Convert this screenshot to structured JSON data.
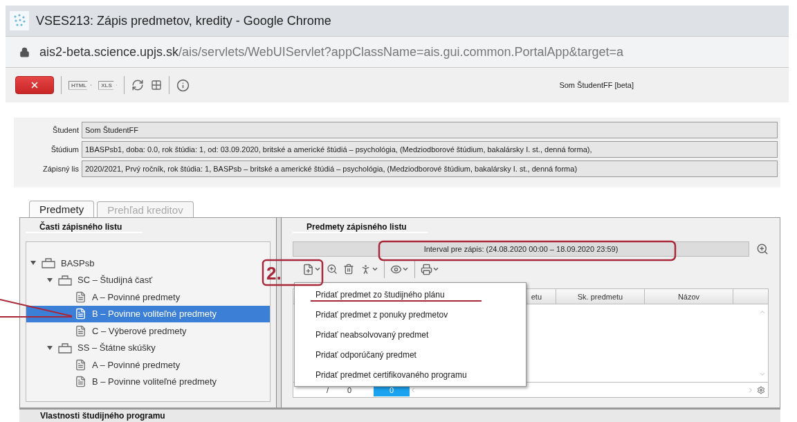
{
  "browser": {
    "title": "VSES213: Zápis predmetov, kredity - Google Chrome",
    "url_host": "ais2-beta.science.upjs.sk",
    "url_path": "/ais/servlets/WebUIServlet?appClassName=ais.gui.common.PortalApp&target=a"
  },
  "toolbar": {
    "export_buttons": [
      "HTML",
      "XLS"
    ],
    "user": "Som ŠtudentFF [beta]"
  },
  "fields": [
    {
      "label": "Študent",
      "value": "Som ŠtudentFF"
    },
    {
      "label": "Štúdium",
      "value": "1BASPsb1, doba: 0.0, rok štúdia: 1, od: 03.09.2020, britské a americké štúdiá – psychológia, (Medziodborové štúdium, bakalársky I. st., denná forma),"
    },
    {
      "label": "Zápisný lis",
      "value": "2020/2021, Prvý ročník, rok štúdia: 1, BASPsb – britské a americké štúdiá – psychológia, (Medziodborové štúdium, bakalársky I. st., denná forma)"
    }
  ],
  "tabs": [
    {
      "label": "Predmety",
      "selected": true
    },
    {
      "label": "Prehľad kreditov",
      "selected": false
    }
  ],
  "left_panel": {
    "title": "Časti zápisného listu",
    "tree": [
      {
        "label": "BASPsb",
        "kind": "group",
        "expanded": true,
        "selected": false,
        "children": [
          {
            "label": "SC – Študijná časť",
            "kind": "group",
            "expanded": true,
            "selected": false,
            "children": [
              {
                "label": "A – Povinné predmety",
                "kind": "part",
                "selected": false
              },
              {
                "label": "B – Povinne voliteľné predmety",
                "kind": "part",
                "selected": true
              },
              {
                "label": "C – Výberové predmety",
                "kind": "part",
                "selected": false
              }
            ]
          },
          {
            "label": "SS – Štátne skúšky",
            "kind": "group",
            "expanded": true,
            "selected": false,
            "children": [
              {
                "label": "A – Povinné predmety",
                "kind": "part",
                "selected": false
              },
              {
                "label": "B – Povinne voliteľné predmety",
                "kind": "part",
                "selected": false
              }
            ]
          }
        ]
      }
    ]
  },
  "right_panel": {
    "title": "Predmety zápisného listu",
    "interval": "Interval pre zápis: (24.08.2020 00:00 – 18.09.2020 23:59)",
    "columns": [
      "etu",
      "Sk. predmetu",
      "Názov"
    ],
    "pager": {
      "separator": "/",
      "total": "0",
      "current": "0"
    },
    "menu": [
      "Pridať predmet zo študijného plánu",
      "Pridať predmet z ponuky predmetov",
      "Pridať neabsolvovaný predmet",
      "Pridať odporúčaný predmet",
      "Pridať predmet certifikovaného programu"
    ]
  },
  "annotation": {
    "step": "2."
  },
  "bottom_panel": {
    "title": "Vlastnosti študijného programu"
  }
}
